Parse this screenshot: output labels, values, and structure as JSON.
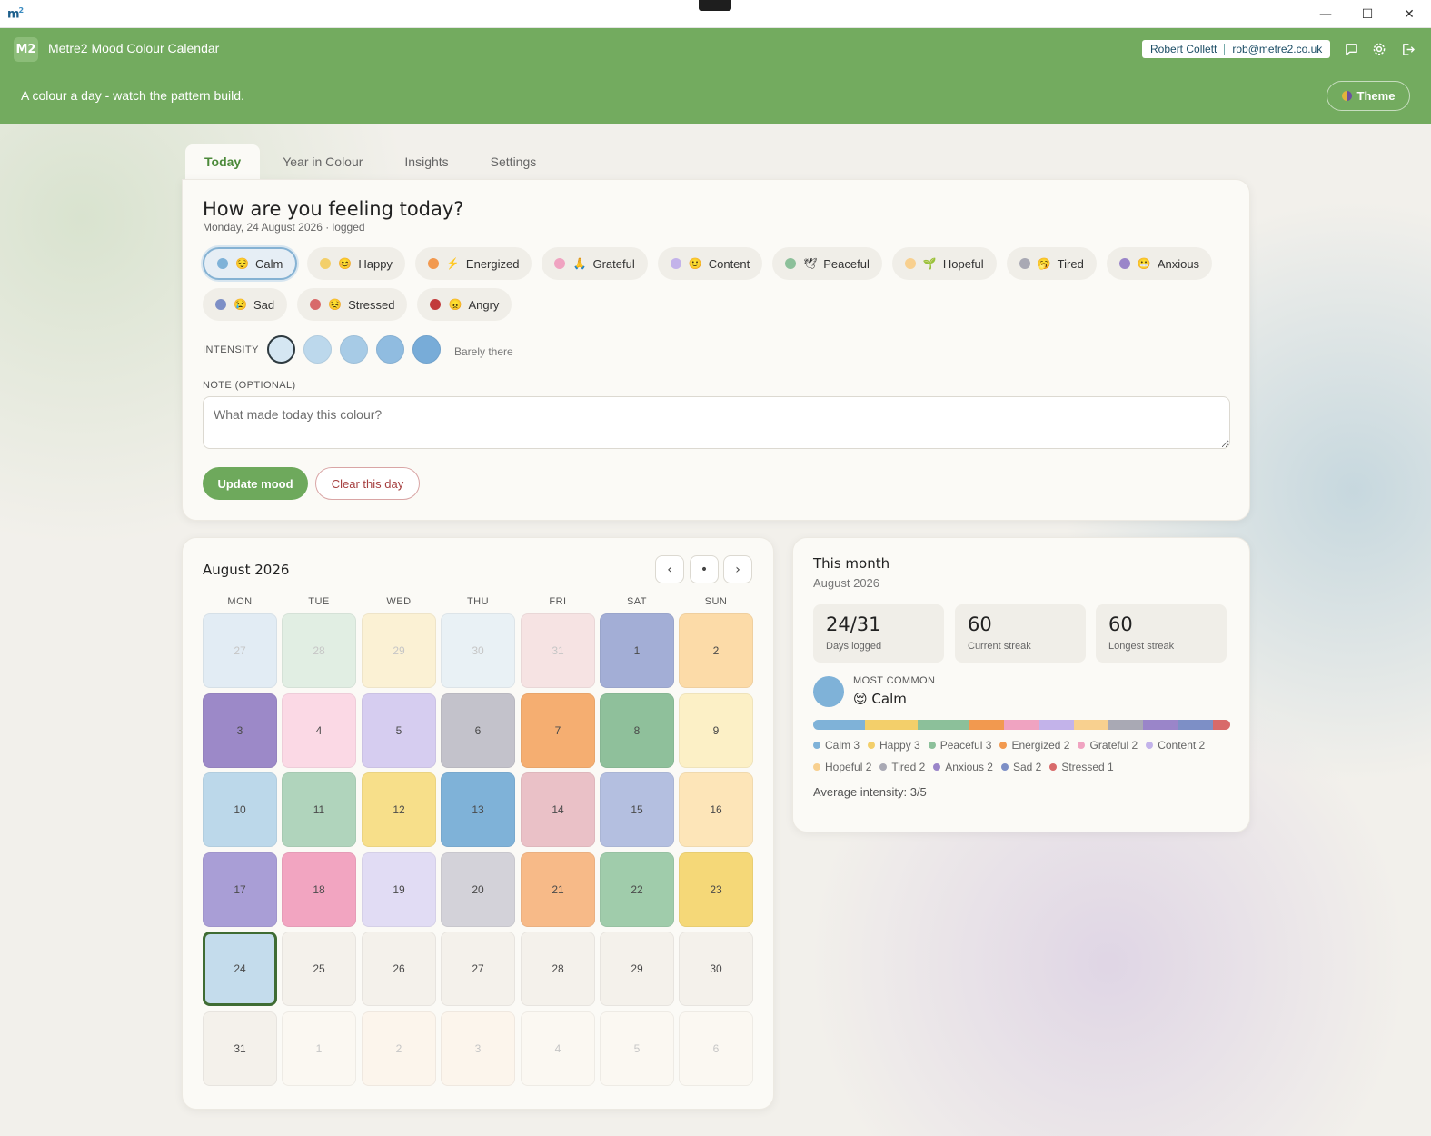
{
  "window": {
    "logo": "m",
    "logo_sup": "2",
    "min": "—",
    "max": "☐",
    "close": "✕"
  },
  "app": {
    "badge": "M2",
    "title": "Metre2 Mood Colour Calendar",
    "tagline": "A colour a day - watch the pattern build.",
    "theme_label": "Theme"
  },
  "user": {
    "name": "Robert Collett",
    "email": "rob@metre2.co.uk"
  },
  "tabs": [
    "Today",
    "Year in Colour",
    "Insights",
    "Settings"
  ],
  "today": {
    "title": "How are you feeling today?",
    "date": "Monday, 24 August 2026 · logged",
    "moods": [
      {
        "label": "Calm",
        "emoji": "😌",
        "color": "#7fb2d8",
        "selected": true
      },
      {
        "label": "Happy",
        "emoji": "😊",
        "color": "#f3cf6a"
      },
      {
        "label": "Energized",
        "emoji": "⚡",
        "color": "#f2994f"
      },
      {
        "label": "Grateful",
        "emoji": "🙏",
        "color": "#f0a3c1"
      },
      {
        "label": "Content",
        "emoji": "🙂",
        "color": "#c3b3ea"
      },
      {
        "label": "Peaceful",
        "emoji": "🕊",
        "color": "#8cc09a"
      },
      {
        "label": "Hopeful",
        "emoji": "🌱",
        "color": "#f8d08f"
      },
      {
        "label": "Tired",
        "emoji": "🥱",
        "color": "#a9a9b4"
      },
      {
        "label": "Anxious",
        "emoji": "😬",
        "color": "#9a85c9"
      },
      {
        "label": "Sad",
        "emoji": "😢",
        "color": "#7d8fc6"
      },
      {
        "label": "Stressed",
        "emoji": "😣",
        "color": "#d86a6a"
      },
      {
        "label": "Angry",
        "emoji": "😠",
        "color": "#c23b3b"
      }
    ],
    "intensity_label": "INTENSITY",
    "intensity_colors": [
      "#d5e6f2",
      "#bcd8ec",
      "#a7cbe6",
      "#90bce0",
      "#78acd8"
    ],
    "intensity_selected": 1,
    "intensity_text": "Barely there",
    "note_label": "NOTE (OPTIONAL)",
    "note_placeholder": "What made today this colour?",
    "update_label": "Update mood",
    "clear_label": "Clear this day"
  },
  "calendar": {
    "title": "August 2026",
    "nav": {
      "prev": "‹",
      "today": "•",
      "next": "›"
    },
    "dow": [
      "MON",
      "TUE",
      "WED",
      "THU",
      "FRI",
      "SAT",
      "SUN"
    ],
    "cells": [
      {
        "d": "27",
        "c": "#e2ecf4",
        "m": true
      },
      {
        "d": "28",
        "c": "#e1eee3",
        "m": true
      },
      {
        "d": "29",
        "c": "#fbf1d4",
        "m": true
      },
      {
        "d": "30",
        "c": "#e9f1f5",
        "m": true
      },
      {
        "d": "31",
        "c": "#f6e3e3",
        "m": true
      },
      {
        "d": "1",
        "c": "#a3aed6"
      },
      {
        "d": "2",
        "c": "#fcdba8"
      },
      {
        "d": "3",
        "c": "#9c89c8"
      },
      {
        "d": "4",
        "c": "#fbd9e5"
      },
      {
        "d": "5",
        "c": "#d6cdf0"
      },
      {
        "d": "6",
        "c": "#c3c2cb"
      },
      {
        "d": "7",
        "c": "#f5ae71"
      },
      {
        "d": "8",
        "c": "#8fc09b"
      },
      {
        "d": "9",
        "c": "#fcf0c6"
      },
      {
        "d": "10",
        "c": "#bcd8ea"
      },
      {
        "d": "11",
        "c": "#b0d4bc"
      },
      {
        "d": "12",
        "c": "#f7df8a"
      },
      {
        "d": "13",
        "c": "#7fb2d8"
      },
      {
        "d": "14",
        "c": "#eac1c7"
      },
      {
        "d": "15",
        "c": "#b4bfe0"
      },
      {
        "d": "16",
        "c": "#fde5b8"
      },
      {
        "d": "17",
        "c": "#a99ed6"
      },
      {
        "d": "18",
        "c": "#f2a5c1"
      },
      {
        "d": "19",
        "c": "#e1dcf4"
      },
      {
        "d": "20",
        "c": "#d3d2d9"
      },
      {
        "d": "21",
        "c": "#f7ba88"
      },
      {
        "d": "22",
        "c": "#a0ccab"
      },
      {
        "d": "23",
        "c": "#f5d878"
      },
      {
        "d": "24",
        "c": "#c4dcec",
        "today": true
      },
      {
        "d": "25",
        "c": "#f4f1eb"
      },
      {
        "d": "26",
        "c": "#f4f1eb"
      },
      {
        "d": "27",
        "c": "#f4f1eb"
      },
      {
        "d": "28",
        "c": "#f4f1eb"
      },
      {
        "d": "29",
        "c": "#f4f1eb"
      },
      {
        "d": "30",
        "c": "#f4f1eb"
      },
      {
        "d": "31",
        "c": "#f4f1eb"
      },
      {
        "d": "1",
        "c": "#fbf8f2",
        "m": true
      },
      {
        "d": "2",
        "c": "#fcf5ec",
        "m": true
      },
      {
        "d": "3",
        "c": "#fcf5ec",
        "m": true
      },
      {
        "d": "4",
        "c": "#fbf8f2",
        "m": true
      },
      {
        "d": "5",
        "c": "#fbf8f2",
        "m": true
      },
      {
        "d": "6",
        "c": "#fbf8f2",
        "m": true
      }
    ]
  },
  "stats": {
    "title": "This month",
    "subtitle": "August 2026",
    "boxes": [
      {
        "value": "24/31",
        "label": "Days logged"
      },
      {
        "value": "60",
        "label": "Current streak"
      },
      {
        "value": "60",
        "label": "Longest streak"
      }
    ],
    "most_common_label": "MOST COMMON",
    "most_common_emoji": "😌",
    "most_common_value": "Calm",
    "most_common_color": "#7fb2d8",
    "breakdown": [
      {
        "label": "Calm 3",
        "color": "#7fb2d8",
        "count": 3
      },
      {
        "label": "Happy 3",
        "color": "#f3cf6a",
        "count": 3
      },
      {
        "label": "Peaceful 3",
        "color": "#8cc09a",
        "count": 3
      },
      {
        "label": "Energized 2",
        "color": "#f2994f",
        "count": 2
      },
      {
        "label": "Grateful 2",
        "color": "#f0a3c1",
        "count": 2
      },
      {
        "label": "Content 2",
        "color": "#c3b3ea",
        "count": 2
      },
      {
        "label": "Hopeful 2",
        "color": "#f8d08f",
        "count": 2
      },
      {
        "label": "Tired 2",
        "color": "#a9a9b4",
        "count": 2
      },
      {
        "label": "Anxious 2",
        "color": "#9a85c9",
        "count": 2
      },
      {
        "label": "Sad 2",
        "color": "#7d8fc6",
        "count": 2
      },
      {
        "label": "Stressed 1",
        "color": "#d86a6a",
        "count": 1
      }
    ],
    "average": "Average intensity: 3/5"
  }
}
